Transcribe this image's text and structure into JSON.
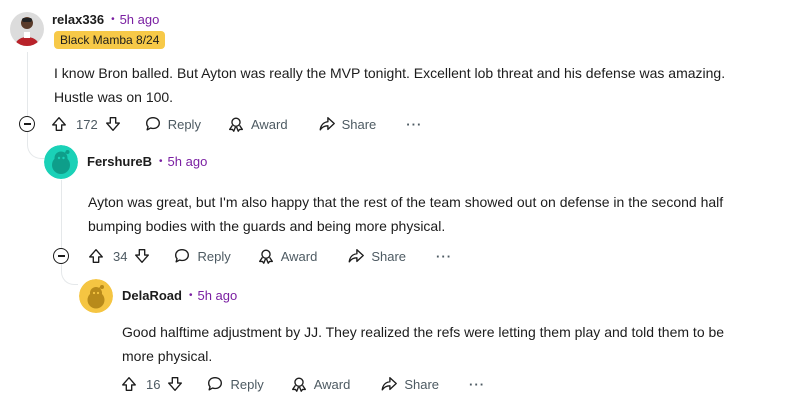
{
  "comments": [
    {
      "username": "relax336",
      "time": "5h ago",
      "flair": "Black Mamba 8/24",
      "body_lines": [
        "I know Bron balled. But Ayton was really the MVP tonight. Excellent lob threat and his defense was amazing.",
        "Hustle was on 100."
      ],
      "votes": "172",
      "reply_label": "Reply",
      "award_label": "Award",
      "share_label": "Share",
      "more_label": "···"
    },
    {
      "username": "FershureB",
      "time": "5h ago",
      "body_lines": [
        "Ayton was great, but I'm also happy that the rest of the team showed out on defense in the second half",
        "bumping bodies with the guards and being more physical."
      ],
      "votes": "34",
      "reply_label": "Reply",
      "award_label": "Award",
      "share_label": "Share",
      "more_label": "···"
    },
    {
      "username": "DelaRoad",
      "time": "5h ago",
      "body_lines": [
        "Good halftime adjustment by JJ. They realized the refs were letting them play and told them to be",
        "more physical."
      ],
      "votes": "16",
      "reply_label": "Reply",
      "award_label": "Award",
      "share_label": "Share",
      "more_label": "···"
    }
  ],
  "separator": "•",
  "colors": {
    "accent": "#7a1fa2",
    "flair_bg": "#f7c948",
    "avatar_teal": "#1ad1b7",
    "avatar_yellow": "#f5c542"
  }
}
